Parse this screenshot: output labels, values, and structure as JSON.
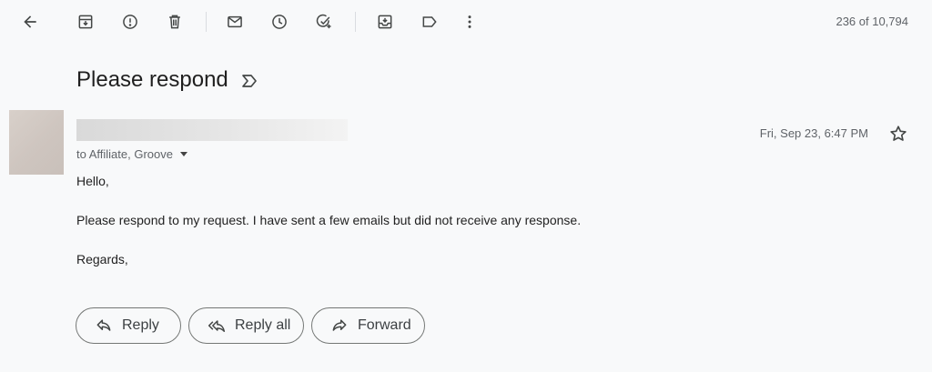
{
  "toolbar": {
    "icons": [
      "back-arrow-icon",
      "archive-icon",
      "report-spam-icon",
      "delete-icon",
      "mark-unread-icon",
      "snooze-icon",
      "add-to-tasks-icon",
      "move-to-icon",
      "label-icon",
      "more-vert-icon"
    ],
    "counter": "236 of 10,794"
  },
  "message": {
    "subject": "Please respond",
    "recipients": "to Affiliate, Groove",
    "date": "Fri, Sep 23, 6:47 PM",
    "body": {
      "greeting": "Hello,",
      "paragraph": "Please respond to my request. I have sent a few emails but did not receive any response.",
      "closing": "Regards,"
    }
  },
  "actions": {
    "reply": "Reply",
    "reply_all": "Reply all",
    "forward": "Forward"
  },
  "colors": {
    "background": "#f8f9fa",
    "icon": "#444746",
    "secondary_text": "#5f6368",
    "button_border": "#747775"
  }
}
